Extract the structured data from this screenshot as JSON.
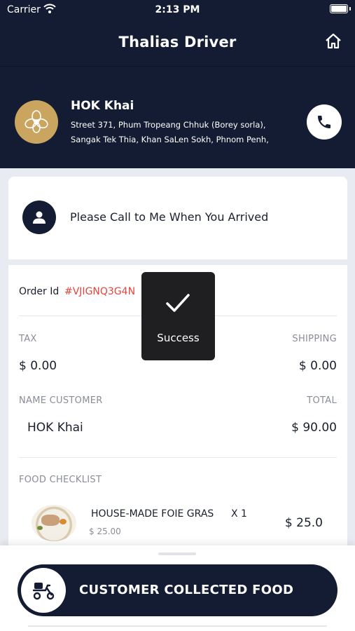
{
  "status_bar": {
    "carrier": "Carrier",
    "time": "2:13 PM"
  },
  "nav": {
    "title": "Thalias Driver",
    "home_icon": "home-icon"
  },
  "customer": {
    "name": "HOK Khai",
    "address_line1": "Street 371, Phum Tropeang Chhuk (Borey sorla),",
    "address_line2": "Sangak Tek Thia, Khan SaLen Sokh, Phnom Penh,",
    "avatar_icon": "flower-logo-icon",
    "call_icon": "phone-icon"
  },
  "note": {
    "text": "Please Call to Me When You Arrived",
    "icon": "person-icon"
  },
  "order": {
    "order_label": "Order Id",
    "order_id": "#VJIGNQ3G4N",
    "tax_label": "TAX",
    "tax_value": "$ 0.00",
    "shipping_label": "SHIPPING",
    "shipping_value": "$ 0.00",
    "name_label": "NAME CUSTOMER",
    "name_value": "HOK Khai",
    "total_label": "TOTAL",
    "total_value": "$ 90.00",
    "checklist_label": "FOOD CHECKLIST",
    "items": [
      {
        "name": "HOUSE-MADE FOIE GRAS",
        "qty": "X 1",
        "unit_price": "$ 25.00",
        "price": "$ 25.0"
      }
    ]
  },
  "toast": {
    "message": "Success",
    "icon": "checkmark-icon"
  },
  "action": {
    "label": "CUSTOMER COLLECTED FOOD",
    "icon": "scooter-icon"
  },
  "colors": {
    "navy": "#141c33",
    "gold": "#c9a560",
    "accent_red": "#e2453b",
    "background": "#e9ebf2"
  }
}
